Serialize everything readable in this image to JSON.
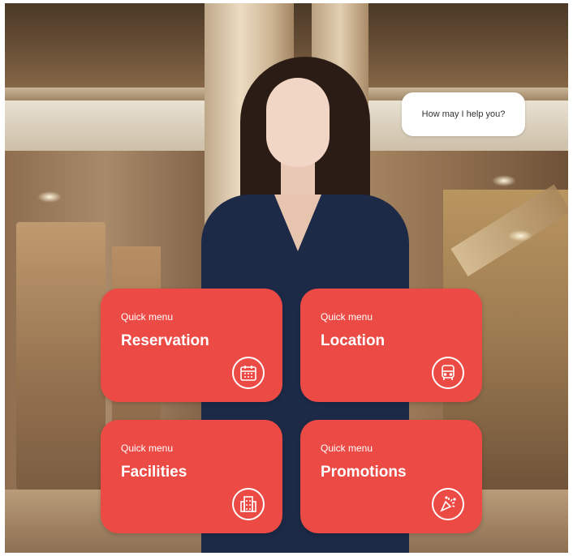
{
  "speech_bubble": {
    "text": "How may I help you?"
  },
  "quick_menu": {
    "items": [
      {
        "kicker": "Quick menu",
        "label": "Reservation",
        "icon": "calendar-icon"
      },
      {
        "kicker": "Quick menu",
        "label": "Location",
        "icon": "bus-icon"
      },
      {
        "kicker": "Quick menu",
        "label": "Facilities",
        "icon": "building-icon"
      },
      {
        "kicker": "Quick menu",
        "label": "Promotions",
        "icon": "party-popper-icon"
      }
    ]
  },
  "colors": {
    "card_bg": "#ec4a45",
    "card_text": "#ffffff",
    "bubble_bg": "#ffffff",
    "suit": "#1c2a48"
  }
}
